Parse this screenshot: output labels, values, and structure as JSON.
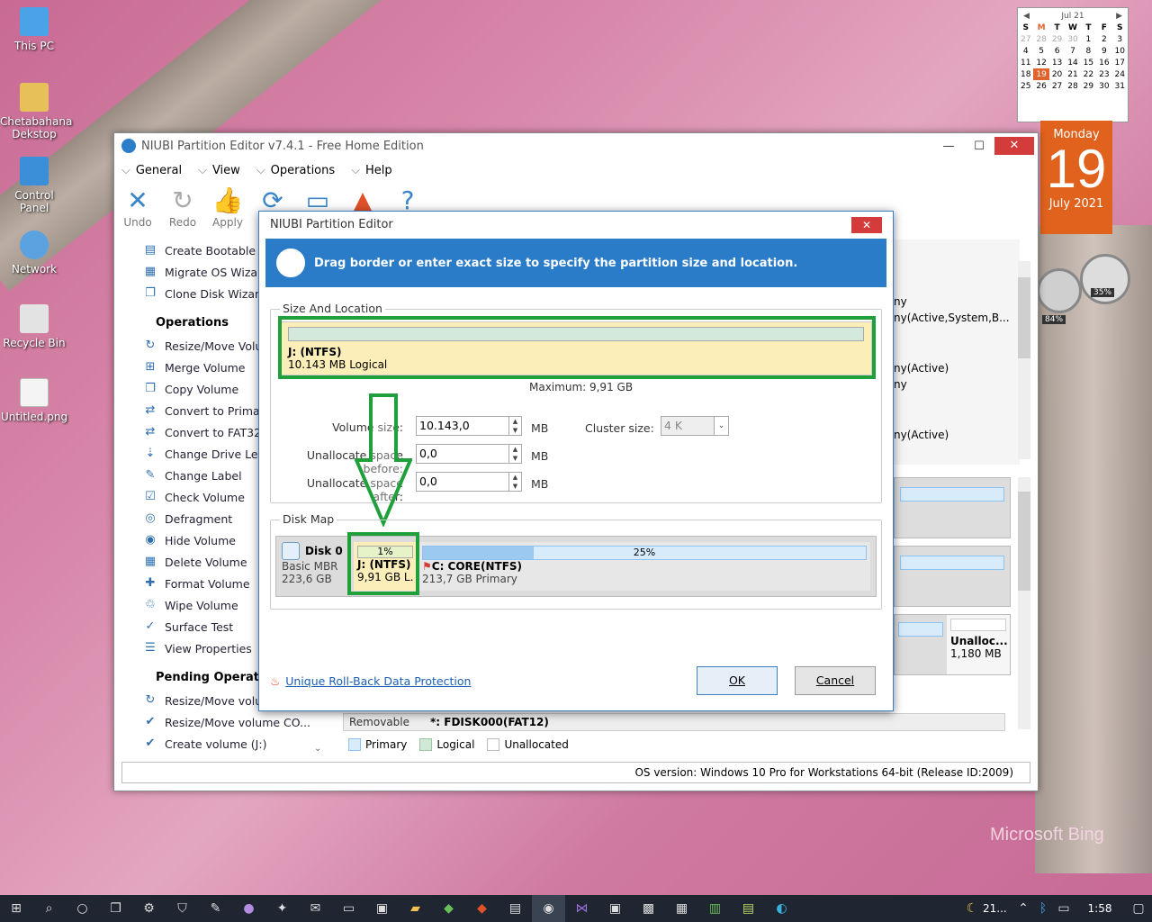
{
  "desktop": {
    "icons": [
      "This PC",
      "Chetabahana Dekstop",
      "Control Panel",
      "Network",
      "Recycle Bin",
      "Untitled.png"
    ],
    "watermark": "Microsoft Bing"
  },
  "calendar": {
    "month": "Jul 21",
    "headers": [
      "S",
      "M",
      "T",
      "W",
      "T",
      "F",
      "S"
    ],
    "rows": [
      [
        "27",
        "28",
        "29",
        "30",
        "1",
        "2",
        "3"
      ],
      [
        "4",
        "5",
        "6",
        "7",
        "8",
        "9",
        "10"
      ],
      [
        "11",
        "12",
        "13",
        "14",
        "15",
        "16",
        "17"
      ],
      [
        "18",
        "19",
        "20",
        "21",
        "22",
        "23",
        "24"
      ],
      [
        "25",
        "26",
        "27",
        "28",
        "29",
        "30",
        "31"
      ]
    ],
    "weekday": "Monday",
    "day": "19",
    "month_year": "July 2021"
  },
  "gauges": {
    "cpu": "84%",
    "mem": "35%"
  },
  "app": {
    "title": "NIUBI Partition Editor v7.4.1 - Free Home Edition",
    "menu": [
      "General",
      "View",
      "Operations",
      "Help"
    ],
    "toolbar": [
      "Undo",
      "Redo",
      "Apply",
      "Refresh",
      "",
      "",
      ""
    ],
    "sidebar_top": [
      "Create Bootable M",
      "Migrate OS Wizard",
      "Clone Disk Wizard"
    ],
    "operations_header": "Operations",
    "operations": [
      "Resize/Move Volur",
      "Merge Volume",
      "Copy Volume",
      "Convert to Primary",
      "Convert to FAT32",
      "Change Drive Lette",
      "Change Label",
      "Check Volume",
      "Defragment",
      "Hide Volume",
      "Delete Volume",
      "Format Volume",
      "Wipe Volume",
      "Surface Test",
      "View Properties"
    ],
    "pending_header": "Pending Operation",
    "pending": [
      "Resize/Move volur",
      "Resize/Move volume CO...",
      "Create volume (J:)"
    ],
    "right_list": [
      "ny",
      "ny(Active,System,B...",
      "ny(Active)",
      "ny",
      "ny(Active)"
    ],
    "unalloc_label": "Unalloc...",
    "unalloc_size": "1,180 MB",
    "removable": "Removable",
    "fdisk": "*: FDISK000(FAT12)",
    "legend": [
      "Primary",
      "Logical",
      "Unallocated"
    ],
    "status": "OS version: Windows 10 Pro for Workstations  64-bit  (Release ID:2009)"
  },
  "dialog": {
    "title": "NIUBI Partition Editor",
    "close": "✕",
    "banner": "Drag border or enter exact size to specify the partition size and location.",
    "group1": "Size And Location",
    "part_name": "J: (NTFS)",
    "part_size": "10.143 MB Logical",
    "maximum": "Maximum: 9,91 GB",
    "volume_size_label": "Volume size:",
    "volume_size": "10.143,0",
    "before_label": "Unallocate space before:",
    "before": "0,0",
    "after_label": "Unallocate space after:",
    "after": "0,0",
    "unit": "MB",
    "cluster_label": "Cluster size:",
    "cluster": "4 K",
    "group2": "Disk Map",
    "disk_name": "Disk 0",
    "disk_type": "Basic MBR",
    "disk_size": "223,6 GB",
    "j_pct": "1%",
    "j_name": "J: (NTFS)",
    "j_size": "9,91 GB L.",
    "c_pct": "25%",
    "c_name": "C: CORE(NTFS)",
    "c_size": "213,7 GB Primary",
    "link": "Unique Roll-Back Data Protection",
    "ok": "OK",
    "cancel": "Cancel"
  },
  "taskbar": {
    "weather": "21...",
    "time": "1:58"
  }
}
